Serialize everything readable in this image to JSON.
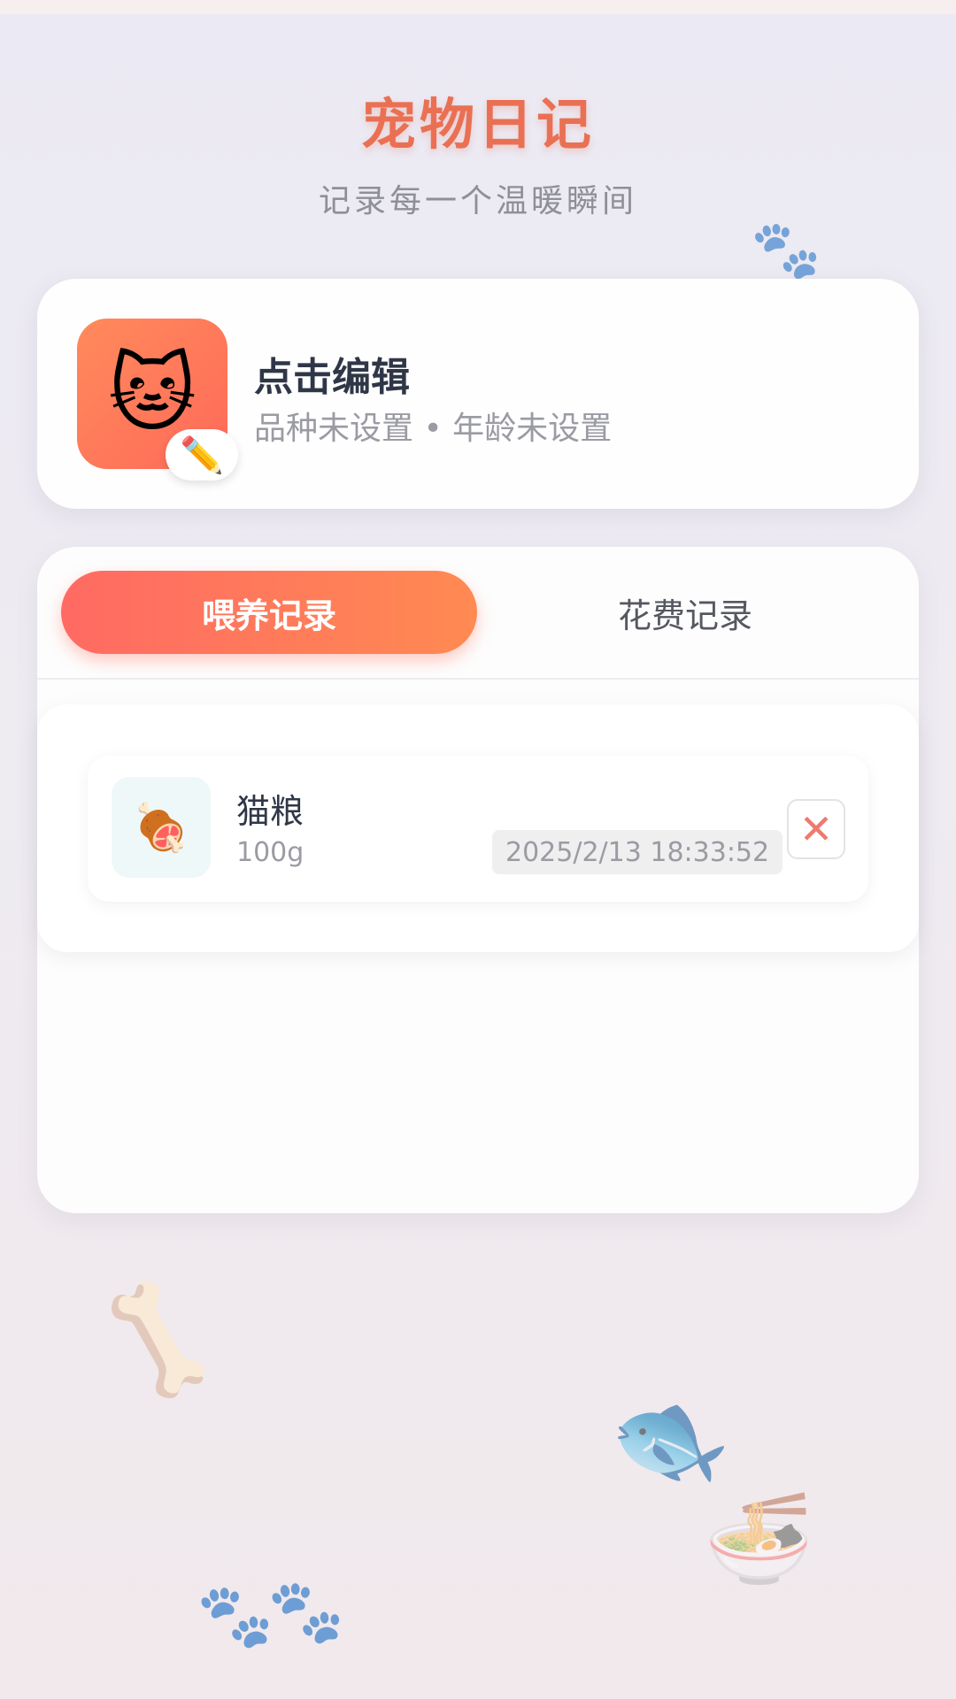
{
  "header": {
    "title": "宠物日记",
    "subtitle": "记录每一个温暖瞬间"
  },
  "profile": {
    "name": "点击编辑",
    "meta": "品种未设置 • 年龄未设置",
    "avatar_icon": "cat-face-icon",
    "edit_icon": "pencil-icon"
  },
  "tabs": [
    {
      "label": "喂养记录",
      "active": true
    },
    {
      "label": "花费记录",
      "active": false
    }
  ],
  "records": [
    {
      "name": "猫粮",
      "amount": "100g",
      "time": "2025/2/13 18:33:52",
      "icon": "meat-icon"
    }
  ],
  "colors": {
    "accent": "#ea7054",
    "tab_gradient_start": "#ff6a63",
    "tab_gradient_end": "#ff8a52",
    "delete": "#ef7a70"
  },
  "decorations": [
    "paw-icon",
    "bone-icon",
    "fish-icon",
    "bowl-icon"
  ]
}
